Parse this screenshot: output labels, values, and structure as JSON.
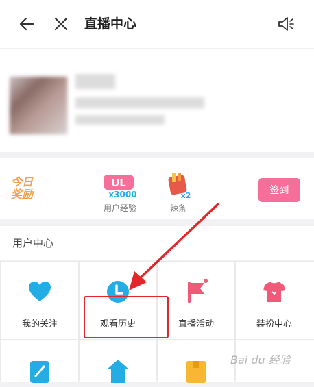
{
  "header": {
    "title": "直播中心"
  },
  "reward": {
    "today_label": "今日奖励",
    "items": [
      {
        "badge_text": "UL",
        "badge_amount": "x3000",
        "label": "用户经验"
      },
      {
        "badge_text": "",
        "badge_amount": "x2",
        "label": "辣条"
      }
    ],
    "signin_label": "签到"
  },
  "user_center": {
    "title": "用户中心",
    "items": [
      {
        "label": "我的关注",
        "icon": "heart-icon"
      },
      {
        "label": "观看历史",
        "icon": "clock-icon"
      },
      {
        "label": "直播活动",
        "icon": "flag-icon"
      },
      {
        "label": "装扮中心",
        "icon": "shirt-icon"
      }
    ],
    "row2_icons": [
      "edit-icon",
      "home-icon",
      "box-icon"
    ]
  },
  "watermark": "Bai du 经验",
  "colors": {
    "accent_pink": "#f56f9a",
    "icon_blue": "#23ade5",
    "highlight_red": "#e3262a",
    "reward_orange": "#f4a04e"
  }
}
